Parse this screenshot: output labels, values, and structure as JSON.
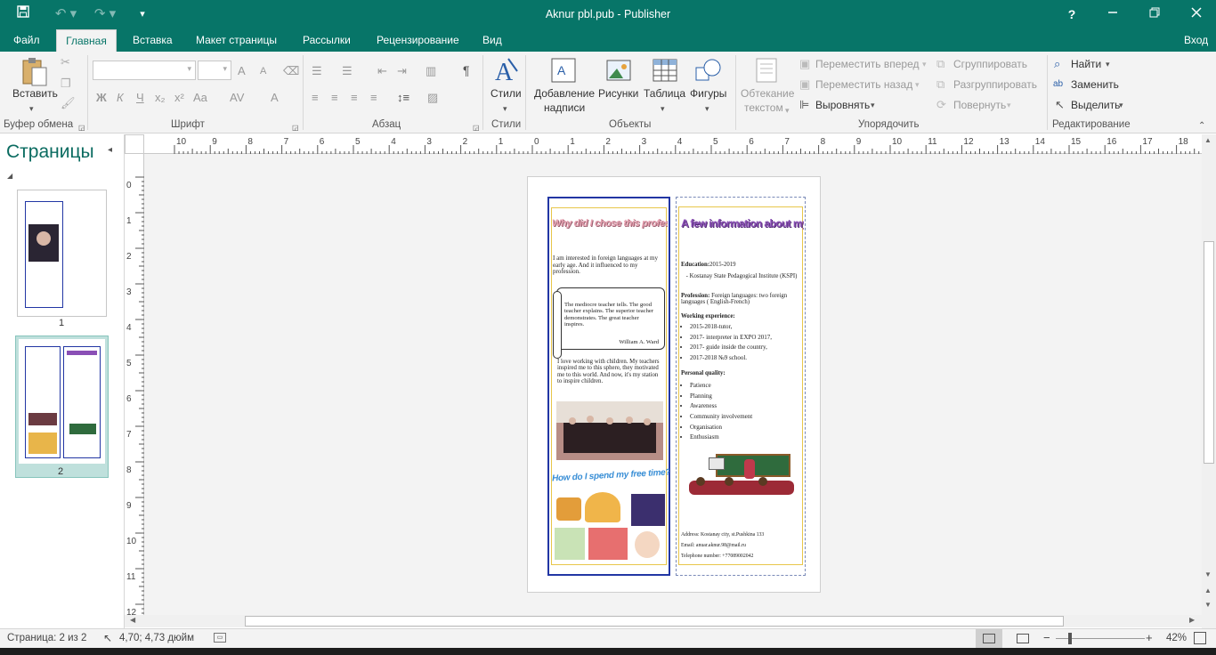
{
  "window": {
    "title": "Aknur pbl.pub - Publisher",
    "help": "?",
    "signin": "Вход"
  },
  "menu_tabs": [
    "Файл",
    "Главная",
    "Вставка",
    "Макет страницы",
    "Рассылки",
    "Рецензирование",
    "Вид"
  ],
  "ribbon": {
    "clipboard": {
      "paste": "Вставить",
      "group": "Буфер обмена"
    },
    "font": {
      "group": "Шрифт",
      "bold": "Ж",
      "italic": "К",
      "underline": "Ч",
      "sub": "x₂",
      "sup": "x²",
      "case": "Aa",
      "spacing": "AV",
      "color": "A",
      "grow": "A",
      "shrink": "A"
    },
    "paragraph": {
      "group": "Абзац",
      "pilcrow": "¶"
    },
    "styles": {
      "label": "Стили",
      "group": "Стили"
    },
    "objects": {
      "group": "Объекты",
      "textbox_line1": "Добавление",
      "textbox_line2": "надписи",
      "pictures": "Рисунки",
      "table": "Таблица",
      "shapes": "Фигуры"
    },
    "arrange": {
      "group": "Упорядочить",
      "wrap_line1": "Обтекание",
      "wrap_line2": "текстом",
      "forward": "Переместить вперед",
      "backward": "Переместить назад",
      "align": "Выровнять",
      "group_btn": "Сгруппировать",
      "ungroup": "Разгруппировать",
      "rotate": "Повернуть"
    },
    "editing": {
      "group": "Редактирование",
      "find": "Найти",
      "replace": "Заменить",
      "select": "Выделить"
    }
  },
  "pages_panel": {
    "title": "Страницы",
    "page_numbers": [
      "1",
      "2"
    ]
  },
  "ruler": {
    "h_labels": [
      "10",
      "9",
      "8",
      "7",
      "6",
      "5",
      "4",
      "3",
      "2",
      "1",
      "0",
      "1",
      "2",
      "3",
      "4",
      "5",
      "6",
      "7",
      "8",
      "9",
      "10",
      "11",
      "12",
      "13",
      "14",
      "15",
      "16",
      "17",
      "18"
    ],
    "v_labels": [
      "0",
      "1",
      "2",
      "3",
      "4",
      "5",
      "6",
      "7",
      "8",
      "9",
      "10",
      "11",
      "12"
    ]
  },
  "brochure": {
    "left": {
      "heading": "Why did I chose this profession?",
      "intro": "I am interested in foreign languages at my early age. And it influenced to my profession.",
      "quote": "The mediocre teacher tells. The good teacher explains. The superior teacher demonstrates. The great teacher inspires.",
      "quote_author": "William A. Ward",
      "para2": "I love working with children. My teachers inspired me to this sphere, they motivated me to this world. And now, it's my station to inspire children.",
      "heading2": "How do I spend my free time?"
    },
    "right": {
      "heading": "A few information about myself",
      "education_label": "Education:",
      "education_years": "2015-2019",
      "education_inst": "- Kostanay State Pedagogical Institute (KSPI)",
      "profession_label": "Profession:",
      "profession_text": "Foreign languages: two foreign languages ( English-French)",
      "experience_label": "Working experience:",
      "experience": [
        "2015-2018-tutor,",
        "2017- interpreter in EXPO 2017,",
        "2017- guide inside the country,",
        "2017-2018 №9 school."
      ],
      "quality_label": "Personal quality:",
      "qualities": [
        "Patience",
        "Planning",
        "Awareness",
        "Community involvement",
        "Organisation",
        "Enthusiasm"
      ],
      "address": "Address: Kostanay city, st.Pushkina 133",
      "email": "Email: anuar.aknur.98@mail.ru",
      "phone": "Telephone number: +77089002042"
    }
  },
  "status": {
    "page": "Страница: 2 из 2",
    "position": "4,70; 4,73 дюйм",
    "zoom": "42%"
  },
  "colors": {
    "accent": "#077568",
    "brand_text": "#0a6b60",
    "panel_border": "#2236a4",
    "heading_purple": "#8a4fb5"
  }
}
